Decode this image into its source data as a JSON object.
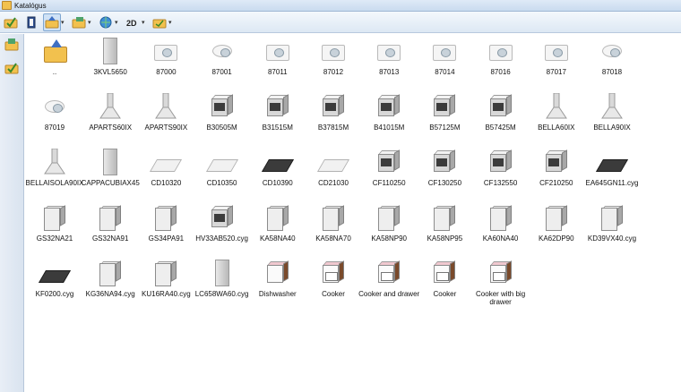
{
  "window": {
    "title": "Katalógus"
  },
  "toolbar": {
    "buttons": [
      {
        "icon": "folder-check-icon"
      },
      {
        "icon": "book-icon"
      },
      {
        "icon": "folder-up-icon"
      },
      {
        "icon": "folder-list-icon"
      },
      {
        "icon": "globe-icon"
      },
      {
        "icon": "2d-view-icon",
        "label": "2D"
      },
      {
        "icon": "folder-view-icon"
      }
    ],
    "dropdown_glyph": "▾"
  },
  "sidebar": {
    "buttons": [
      {
        "icon": "catalog-icon"
      },
      {
        "icon": "folder-check-icon"
      }
    ]
  },
  "items": [
    {
      "label": "..",
      "kind": "up"
    },
    {
      "label": "3KVL5650",
      "kind": "hood"
    },
    {
      "label": "87000",
      "kind": "sink"
    },
    {
      "label": "87001",
      "kind": "sinkround"
    },
    {
      "label": "87011",
      "kind": "sink"
    },
    {
      "label": "87012",
      "kind": "sink"
    },
    {
      "label": "87013",
      "kind": "sink"
    },
    {
      "label": "87014",
      "kind": "sink"
    },
    {
      "label": "87016",
      "kind": "sink"
    },
    {
      "label": "87017",
      "kind": "sink"
    },
    {
      "label": "87018",
      "kind": "sinkround"
    },
    {
      "label": "87019",
      "kind": "sinkround"
    },
    {
      "label": "APARTS60IX",
      "kind": "hoodtri"
    },
    {
      "label": "APARTS90IX",
      "kind": "hoodtri"
    },
    {
      "label": "B30505M",
      "kind": "oven"
    },
    {
      "label": "B31515M",
      "kind": "oven"
    },
    {
      "label": "B37815M",
      "kind": "oven"
    },
    {
      "label": "B41015M",
      "kind": "oven"
    },
    {
      "label": "B57125M",
      "kind": "oven"
    },
    {
      "label": "B57425M",
      "kind": "oven"
    },
    {
      "label": "BELLA60IX",
      "kind": "hoodtri"
    },
    {
      "label": "BELLA90IX",
      "kind": "hoodtri"
    },
    {
      "label": "BELLAISOLA90IX",
      "kind": "hoodtri"
    },
    {
      "label": "CAPPACUBIAX45",
      "kind": "hood"
    },
    {
      "label": "CD10320",
      "kind": "plate"
    },
    {
      "label": "CD10350",
      "kind": "plate"
    },
    {
      "label": "CD10390",
      "kind": "platedark"
    },
    {
      "label": "CD21030",
      "kind": "plate"
    },
    {
      "label": "CF110250",
      "kind": "oven"
    },
    {
      "label": "CF130250",
      "kind": "oven"
    },
    {
      "label": "CF132550",
      "kind": "oven"
    },
    {
      "label": "CF210250",
      "kind": "oven"
    },
    {
      "label": "EA645GN11.cyg",
      "kind": "platedark"
    },
    {
      "label": "GS32NA21",
      "kind": "fridge"
    },
    {
      "label": "GS32NA91",
      "kind": "fridge"
    },
    {
      "label": "GS34PA91",
      "kind": "fridge"
    },
    {
      "label": "HV33AB520.cyg",
      "kind": "oven"
    },
    {
      "label": "KA58NA40",
      "kind": "fridge"
    },
    {
      "label": "KA58NA70",
      "kind": "fridge"
    },
    {
      "label": "KA58NP90",
      "kind": "fridge"
    },
    {
      "label": "KA58NP95",
      "kind": "fridge"
    },
    {
      "label": "KA60NA40",
      "kind": "fridge"
    },
    {
      "label": "KA62DP90",
      "kind": "fridge"
    },
    {
      "label": "KD39VX40.cyg",
      "kind": "fridge"
    },
    {
      "label": "KF0200.cyg",
      "kind": "platedark"
    },
    {
      "label": "KG36NA94.cyg",
      "kind": "fridge"
    },
    {
      "label": "KU16RA40.cyg",
      "kind": "fridge"
    },
    {
      "label": "LC658WA60.cyg",
      "kind": "hood"
    },
    {
      "label": "Dishwasher",
      "kind": "dish"
    },
    {
      "label": "Cooker",
      "kind": "cooker"
    },
    {
      "label": "Cooker and drawer",
      "kind": "cooker"
    },
    {
      "label": "Cooker",
      "kind": "cooker"
    },
    {
      "label": "Cooker with big drawer",
      "kind": "cooker"
    }
  ]
}
